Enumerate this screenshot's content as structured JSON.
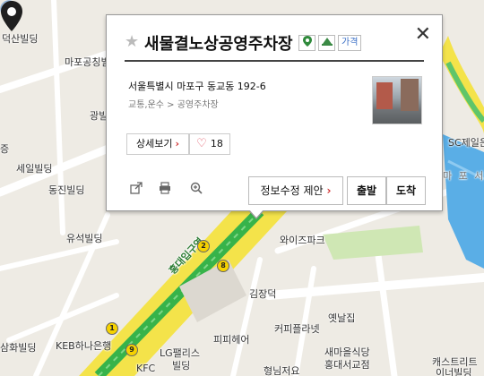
{
  "labels": {
    "deoksan": "덕산빌딩",
    "mapo_gongdeok": "마포공칭빌",
    "gwang": "광빌",
    "jeung": "증",
    "seil": "세일빌딩",
    "dongjin": "동진빌딩",
    "yuseok": "유석빌딩",
    "hongdae_station": "홍대입구역",
    "wise_park": "와이즈파크",
    "gimjangdeok": "김장덕",
    "coffee_planet": "커피플라넷",
    "yeotnal": "옛날집",
    "keb": "KEB하나은행",
    "samhwa": "삼화빌딩",
    "lg_palace": "LG팰리스",
    "lg_palace2": "빌딩",
    "kfc": "KFC",
    "pippi": "피피헤어",
    "saemul_food": "새마을식당",
    "saemul_food2": "홍대서교점",
    "castle": "캐스트리트",
    "castle2": "이너빌딩",
    "sc_bank": "SC제일은",
    "mapo_seo": "마 포 서",
    "hyeongnim": "형님저요"
  },
  "subway_badges": {
    "b2": "2",
    "b8": "8",
    "b1": "1",
    "b9": "9"
  },
  "popup": {
    "title": "새물결노상공영주차장",
    "tag_price": "가격",
    "address": "서울특별시 마포구 동교동 192-6",
    "category": "교통,운수 > 공영주차장",
    "detail_button": "상세보기",
    "like_count": "18",
    "report_button": "정보수정 제안",
    "depart_button": "출발",
    "arrive_button": "도착"
  },
  "icons": [
    "star-icon",
    "pin-tag-icon",
    "parking-tag-icon",
    "close-icon",
    "share-icon",
    "print-icon",
    "zoom-icon",
    "heart-icon",
    "location-marker-icon",
    "map-pin-icon"
  ],
  "colors": {
    "subway_line": "#37b34a",
    "road_yellow": "#f4e34a",
    "water": "#4aa3df",
    "park": "#cfe7b4"
  }
}
